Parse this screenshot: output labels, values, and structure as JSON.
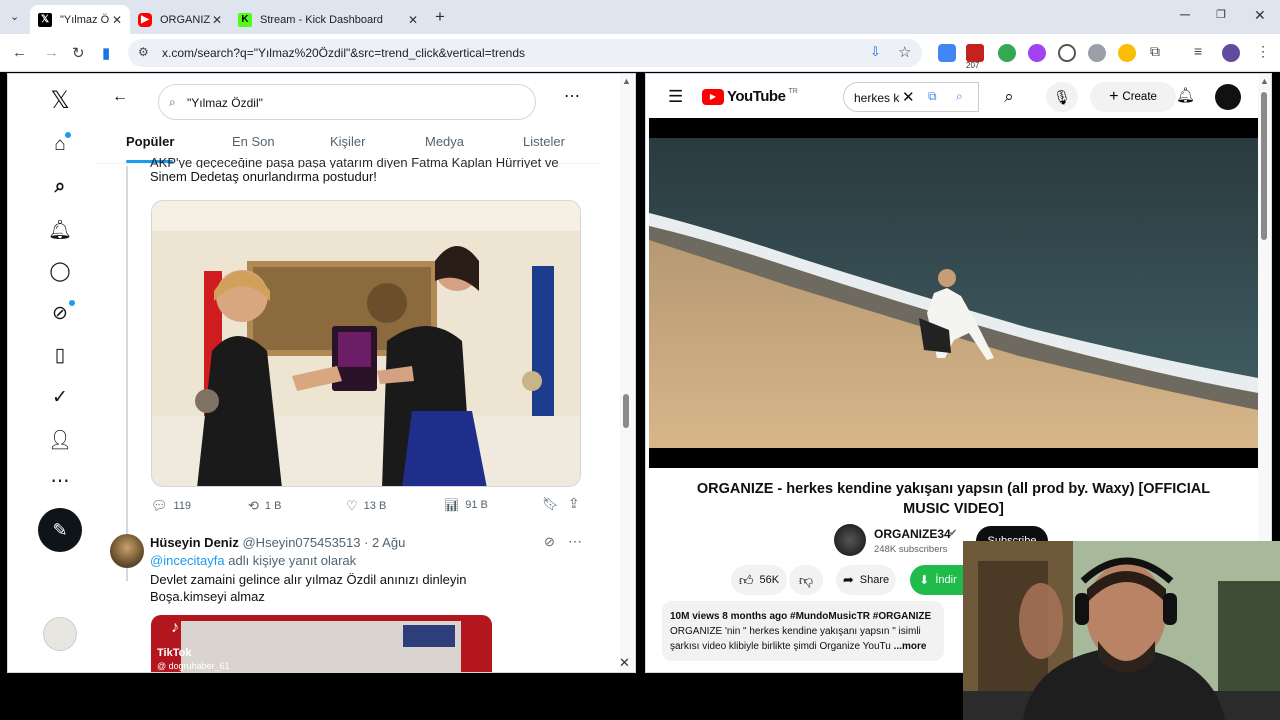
{
  "browser": {
    "tabs": [
      {
        "title": "\"Yılmaz Ö",
        "favicon": "X"
      },
      {
        "title": "ORGANIZ",
        "favicon": "YT"
      },
      {
        "title": "Stream - Kick Dashboard",
        "favicon": "K"
      }
    ],
    "url": "x.com/search?q=\"Yılmaz%20Özdil\"&src=trend_click&vertical=trends",
    "extension_badge": "207"
  },
  "x": {
    "search_query": "\"Yılmaz Özdil\"",
    "tabs": [
      "Popüler",
      "En Son",
      "Kişiler",
      "Medya",
      "Listeler"
    ],
    "tweet1": {
      "text_partial": "AKP'ye geçeceğine paşa paşa yatarım diyen Fatma Kaplan Hürriyet ve",
      "text_line2": "Sinem Dedetaş onurlandırma postudur!",
      "stats": {
        "replies": "119",
        "retweets": "1 B",
        "likes": "13 B",
        "views": "91 B"
      }
    },
    "tweet2": {
      "author": "Hüseyin Deniz",
      "handle": "@Hseyin075453513 · 2 Ağu",
      "reply_to_handle": "@incecitayfa",
      "reply_to_suffix": " adlı kişiye yanıt olarak",
      "text_line1": "Devlet zamaini gelince alır yılmaz Özdil anınızı dinleyin",
      "text_line2": "Boşa.kimseyi almaz",
      "media_label": "TikTok",
      "media_handle": "@ dogruhaber_61"
    }
  },
  "youtube": {
    "logo_text": "YouTube",
    "region": "TR",
    "search_value": "herkes k",
    "create_label": "Create",
    "video_title": "ORGANIZE - herkes kendine yakışanı yapsın (all prod by. Waxy) [OFFICIAL MUSIC VIDEO]",
    "channel_name": "ORGANIZE34",
    "subscribers": "248K subscribers",
    "subscribe_label": "Subscribe",
    "likes": "56K",
    "share_label": "Share",
    "download_label": "İndir",
    "views_line": "10M views  8 months ago  #MundoMusicTR #ORGANIZE",
    "desc_line1": "ORGANIZE 'nin \" herkes kendine yakışanı yapsın \" isimli",
    "desc_line2": "şarkısı video klibiyle birlikte şimdi Organize YouTu",
    "more_label": "...more"
  },
  "colors": {
    "x_blue": "#1d9bf0",
    "yt_red": "#ff0000",
    "download_green": "#1fbb4b"
  }
}
